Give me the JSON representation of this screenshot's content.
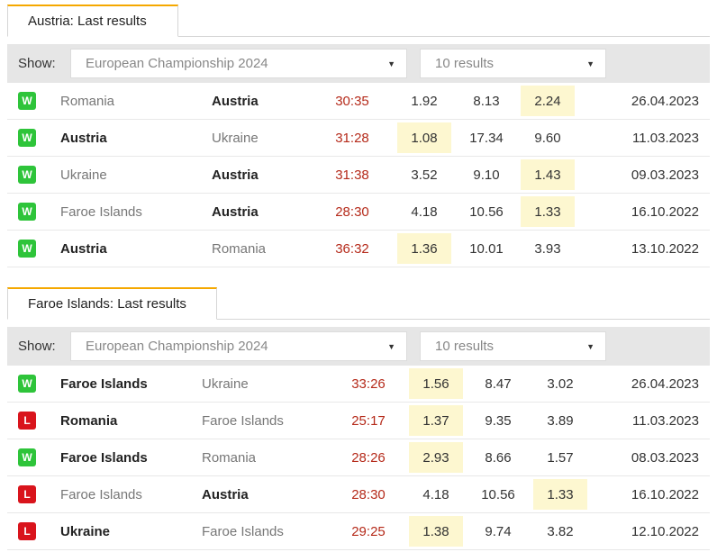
{
  "sections": [
    {
      "tab_label": "Austria: Last results",
      "show_label": "Show:",
      "competition_select": "European Championship 2024",
      "count_select": "10 results",
      "rows": [
        {
          "result": "W",
          "home": "Romania",
          "away": "Austria",
          "winner": "away",
          "score": "30:35",
          "o1": "1.92",
          "ox": "8.13",
          "o2": "2.24",
          "hl": 2,
          "date": "26.04.2023"
        },
        {
          "result": "W",
          "home": "Austria",
          "away": "Ukraine",
          "winner": "home",
          "score": "31:28",
          "o1": "1.08",
          "ox": "17.34",
          "o2": "9.60",
          "hl": 0,
          "date": "11.03.2023"
        },
        {
          "result": "W",
          "home": "Ukraine",
          "away": "Austria",
          "winner": "away",
          "score": "31:38",
          "o1": "3.52",
          "ox": "9.10",
          "o2": "1.43",
          "hl": 2,
          "date": "09.03.2023"
        },
        {
          "result": "W",
          "home": "Faroe Islands",
          "away": "Austria",
          "winner": "away",
          "score": "28:30",
          "o1": "4.18",
          "ox": "10.56",
          "o2": "1.33",
          "hl": 2,
          "date": "16.10.2022"
        },
        {
          "result": "W",
          "home": "Austria",
          "away": "Romania",
          "winner": "home",
          "score": "36:32",
          "o1": "1.36",
          "ox": "10.01",
          "o2": "3.93",
          "hl": 0,
          "date": "13.10.2022"
        }
      ]
    },
    {
      "tab_label": "Faroe Islands: Last results",
      "show_label": "Show:",
      "competition_select": "European Championship 2024",
      "count_select": "10 results",
      "rows": [
        {
          "result": "W",
          "home": "Faroe Islands",
          "away": "Ukraine",
          "winner": "home",
          "score": "33:26",
          "o1": "1.56",
          "ox": "8.47",
          "o2": "3.02",
          "hl": 0,
          "date": "26.04.2023"
        },
        {
          "result": "L",
          "home": "Romania",
          "away": "Faroe Islands",
          "winner": "home",
          "score": "25:17",
          "o1": "1.37",
          "ox": "9.35",
          "o2": "3.89",
          "hl": 0,
          "date": "11.03.2023"
        },
        {
          "result": "W",
          "home": "Faroe Islands",
          "away": "Romania",
          "winner": "home",
          "score": "28:26",
          "o1": "2.93",
          "ox": "8.66",
          "o2": "1.57",
          "hl": 0,
          "date": "08.03.2023"
        },
        {
          "result": "L",
          "home": "Faroe Islands",
          "away": "Austria",
          "winner": "away",
          "score": "28:30",
          "o1": "4.18",
          "ox": "10.56",
          "o2": "1.33",
          "hl": 2,
          "date": "16.10.2022"
        },
        {
          "result": "L",
          "home": "Ukraine",
          "away": "Faroe Islands",
          "winner": "home",
          "score": "29:25",
          "o1": "1.38",
          "ox": "9.74",
          "o2": "3.82",
          "hl": 0,
          "date": "12.10.2022"
        }
      ]
    }
  ]
}
